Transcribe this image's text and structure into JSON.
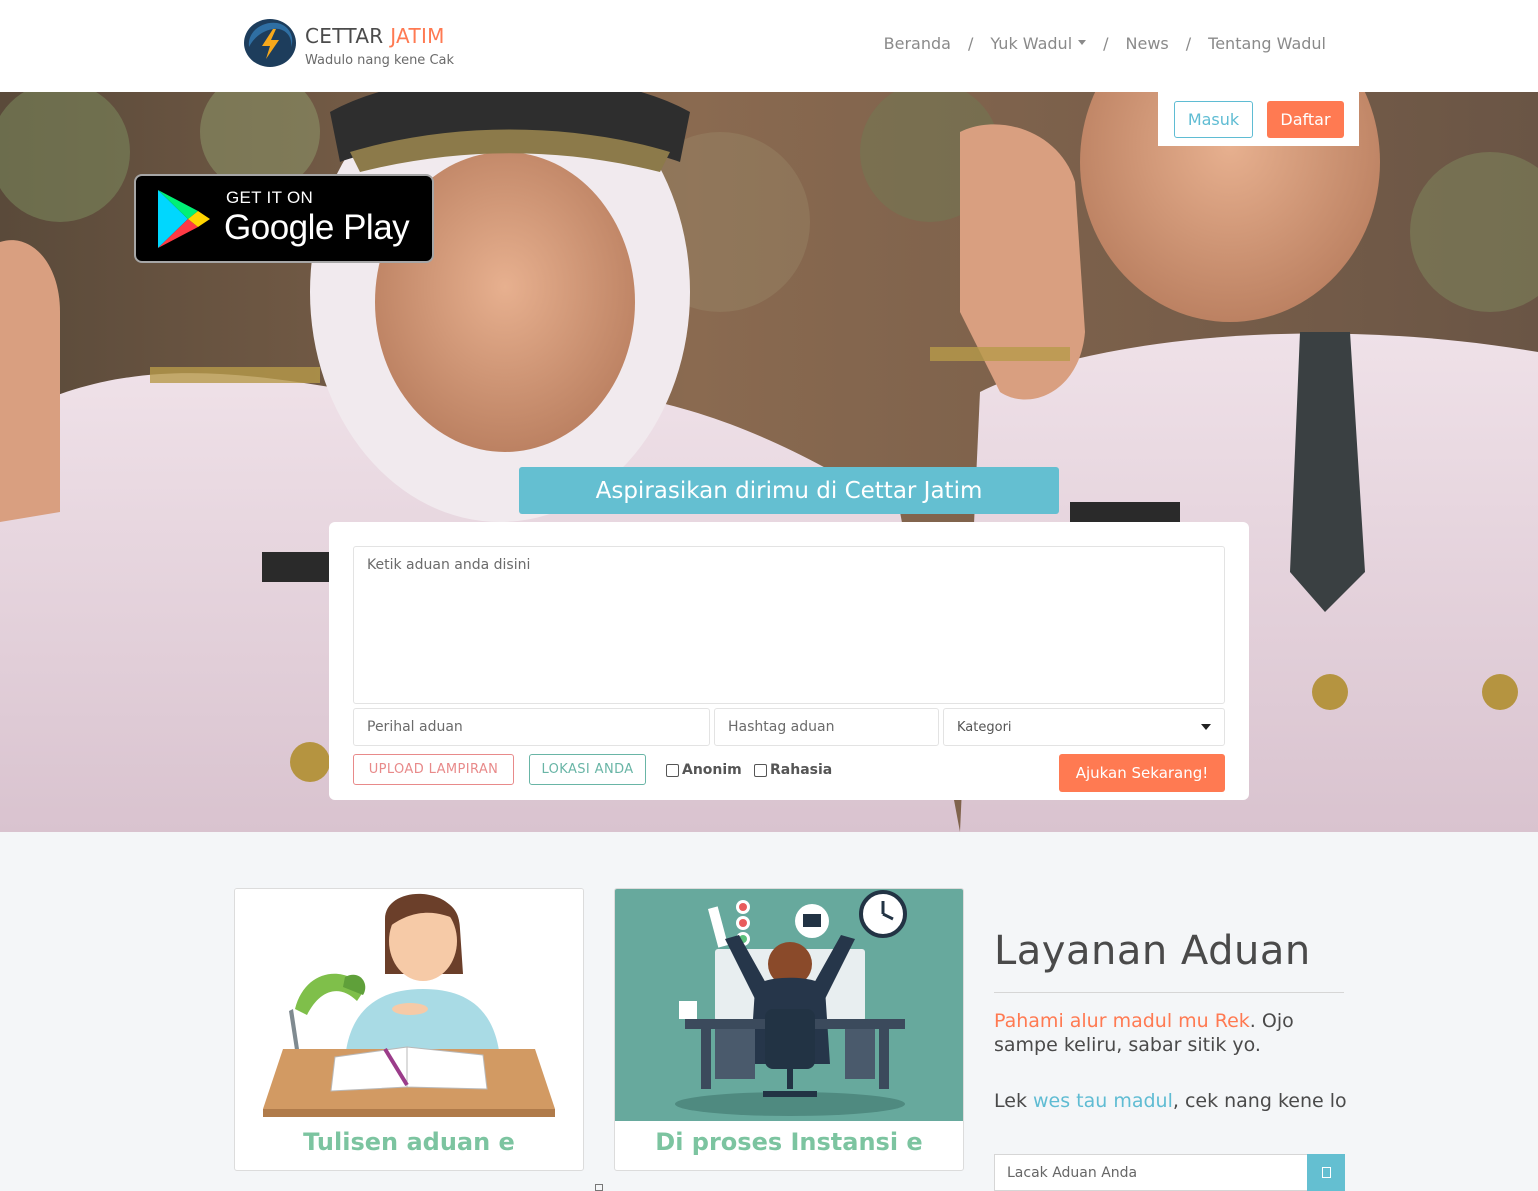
{
  "header": {
    "brand_part1": "CETTAR",
    "brand_part2": "JATIM",
    "tagline": "Wadulo nang kene Cak",
    "nav": [
      "Beranda",
      "Yuk Wadul",
      "News",
      "Tentang Wadul"
    ],
    "nav_separator": "/",
    "login_label": "Masuk",
    "register_label": "Daftar"
  },
  "hero": {
    "google_play_small": "GET IT ON",
    "google_play_big": "Google Play",
    "title": "Aspirasikan dirimu di Cettar Jatim"
  },
  "form": {
    "complaint_placeholder": "Ketik aduan anda disini",
    "subject_placeholder": "Perihal aduan",
    "hashtag_placeholder": "Hashtag aduan",
    "category_label": "Kategori",
    "upload_label": "UPLOAD LAMPIRAN",
    "location_label": "LOKASI ANDA",
    "anonymous_label": "Anonim",
    "private_label": "Rahasia",
    "submit_label": "Ajukan Sekarang!"
  },
  "cards": [
    {
      "caption": "Tulisen aduan e",
      "icon": "person-writing-illustration"
    },
    {
      "caption": "Di proses Instansi e",
      "icon": "office-worker-illustration"
    }
  ],
  "service": {
    "title": "Layanan Aduan",
    "p1_link": "Pahami alur madul mu Rek",
    "p1_rest": ". Ojo sampe keliru, sabar sitik yo.",
    "p2_start": "Lek ",
    "p2_link": "wes tau madul",
    "p2_rest": ", cek nang kene lo",
    "track_placeholder": "Lacak Aduan Anda"
  },
  "colors": {
    "accent_orange": "#ff7a52",
    "accent_teal": "#5fbcd3",
    "card_caption": "#7cc4a0"
  }
}
